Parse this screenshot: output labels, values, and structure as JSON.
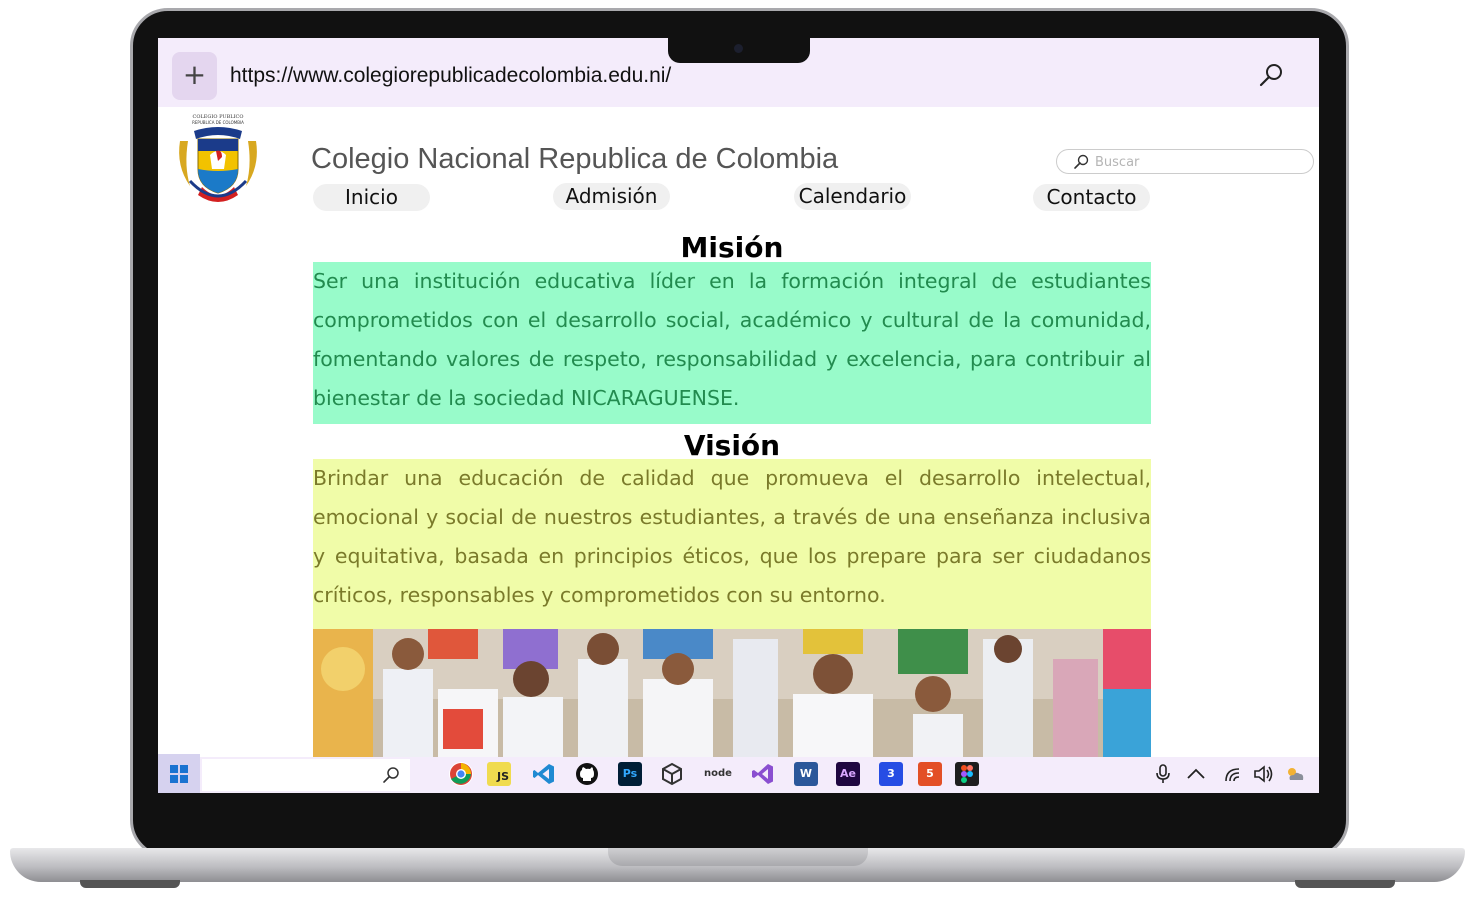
{
  "browser": {
    "new_tab_label": "+",
    "url": "https://www.colegiorepublicadecolombia.edu.ni/"
  },
  "header": {
    "crest_text": [
      "COLEGIO PUBLICO",
      "REPUBLICA DE COLOMBIA"
    ],
    "site_title": "Colegio Nacional Republica de Colombia",
    "search_placeholder": "Buscar"
  },
  "nav": {
    "items": [
      {
        "label": "Inicio"
      },
      {
        "label": "Admisión"
      },
      {
        "label": "Calendario"
      },
      {
        "label": "Contacto"
      }
    ]
  },
  "mision": {
    "title": "Misión",
    "text": "Ser una institución educativa líder en la formación integral de estudiantes comprometidos con el desarrollo social, académico y cultural de la comunidad, fomentando valores de respeto, responsabilidad y excelencia, para contribuir al bienestar de la sociedad NICARAGUENSE.",
    "bg_color": "#98fbca"
  },
  "vision": {
    "title": "Visión",
    "text": "Brindar una educación de calidad que promueva el desarrollo intelectual, emocional y social de nuestros estudiantes, a través de una enseñanza inclusiva y equitativa, basada en principios éticos, que los prepare para ser ciudadanos críticos, responsables y comprometidos con su entorno.",
    "bg_color": "#f0fca8"
  },
  "taskbar": {
    "apps": [
      {
        "icon": "chrome-icon",
        "label": ""
      },
      {
        "icon": "javascript-icon",
        "label": "JS"
      },
      {
        "icon": "vscode-icon",
        "label": ""
      },
      {
        "icon": "github-icon",
        "label": ""
      },
      {
        "icon": "photoshop-icon",
        "label": "Ps"
      },
      {
        "icon": "unity-icon",
        "label": ""
      },
      {
        "icon": "nodejs-icon",
        "label": "node"
      },
      {
        "icon": "visual-studio-icon",
        "label": ""
      },
      {
        "icon": "word-icon",
        "label": "W"
      },
      {
        "icon": "after-effects-icon",
        "label": "Ae"
      },
      {
        "icon": "css3-icon",
        "label": "3"
      },
      {
        "icon": "html5-icon",
        "label": "5"
      },
      {
        "icon": "figma-icon",
        "label": ""
      }
    ],
    "tray": [
      "microphone-icon",
      "chevron-up-icon",
      "wifi-icon",
      "volume-icon",
      "weather-icon"
    ]
  }
}
